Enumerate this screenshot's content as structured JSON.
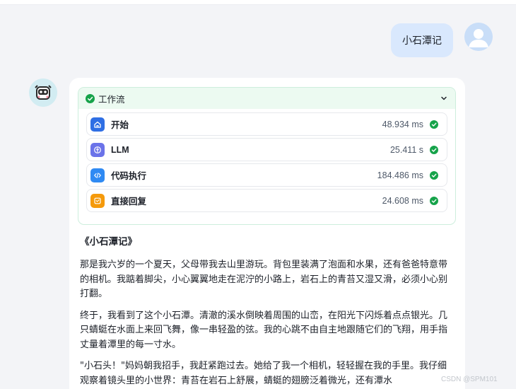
{
  "user_message": {
    "text": "小石潭记"
  },
  "workflow": {
    "title": "工作流",
    "status_color": "#16a34a",
    "nodes": [
      {
        "label": "开始",
        "time": "48.934 ms",
        "icon": "home-icon",
        "icon_color": "#2f6fe4"
      },
      {
        "label": "LLM",
        "time": "25.411 s",
        "icon": "llm-icon",
        "icon_color": "#6b73e9"
      },
      {
        "label": "代码执行",
        "time": "184.486 ms",
        "icon": "code-icon",
        "icon_color": "#2f8af3"
      },
      {
        "label": "直接回复",
        "time": "24.608 ms",
        "icon": "reply-icon",
        "icon_color": "#f59a0b"
      }
    ]
  },
  "answer": {
    "title": "《小石潭记》",
    "paragraphs": [
      "那是我六岁的一个夏天，父母带我去山里游玩。背包里装满了泡面和水果，还有爸爸特意带的相机。我踮着脚尖，小心翼翼地走在泥泞的小路上，岩石上的青苔又湿又滑，必须小心别打翻。",
      "终于，我看到了这个小石潭。清澈的溪水倒映着周围的山峦，在阳光下闪烁着点点银光。几只蜻蜓在水面上来回飞舞，像一串轻盈的弦。我的心跳不由自主地跟随它们的飞翔，用手指丈量着潭里的每一寸水。",
      "\"小石头！\"妈妈朝我招手，我赶紧跑过去。她给了我一个相机，轻轻握在我的手里。我仔细观察着镜头里的小世界：青苔在岩石上舒展，蜻蜓的翅膀泛着微光，还有潭水"
    ]
  },
  "watermark": "CSDN @SPM101"
}
